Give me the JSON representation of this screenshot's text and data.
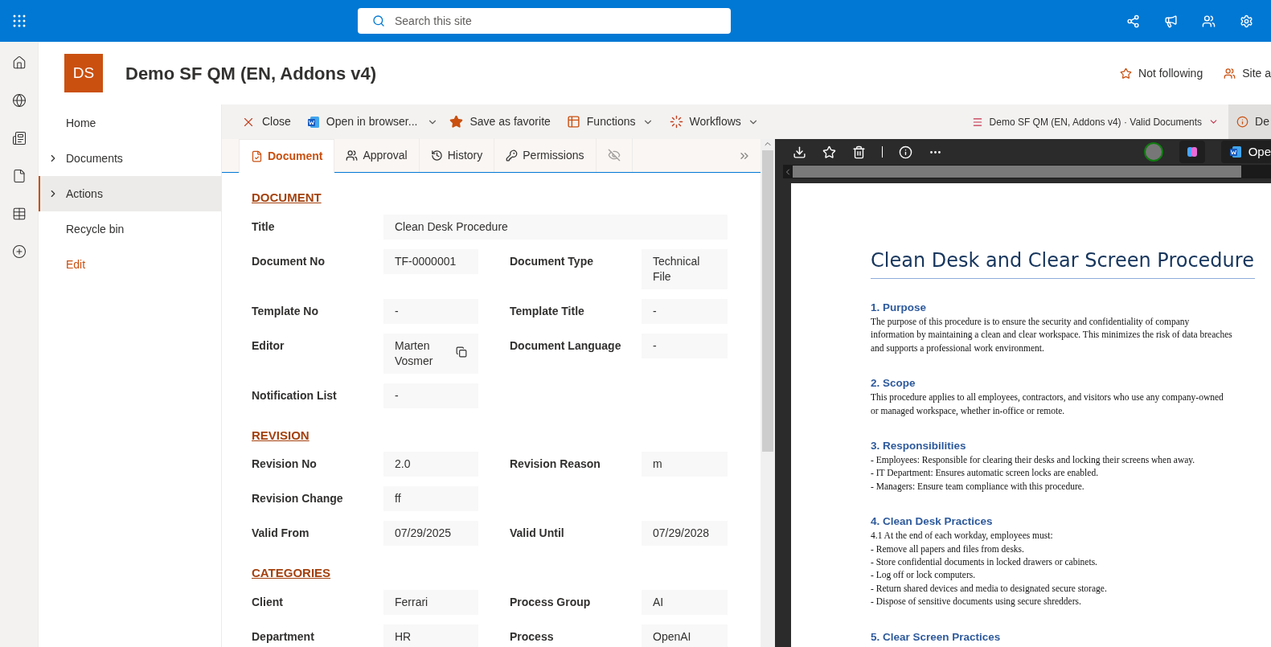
{
  "top_bar": {
    "search": {
      "placeholder": "Search this site"
    }
  },
  "site": {
    "logo": "DS",
    "title": "Demo SF QM (EN, Addons v4)",
    "actions": [
      {
        "kind": "follow",
        "label": "Not following"
      },
      {
        "kind": "members",
        "label": "Site a"
      }
    ]
  },
  "nav": [
    {
      "label": "Home",
      "expandable": false,
      "selected": false,
      "kind": "item"
    },
    {
      "label": "Documents",
      "expandable": true,
      "selected": false,
      "kind": "item"
    },
    {
      "label": "Actions",
      "expandable": true,
      "selected": true,
      "kind": "item"
    },
    {
      "label": "Recycle bin",
      "expandable": false,
      "selected": false,
      "kind": "item"
    },
    {
      "label": "Edit",
      "expandable": false,
      "selected": false,
      "kind": "link"
    }
  ],
  "command_bar": {
    "commands": [
      {
        "kind": "close",
        "label": "Close",
        "dropdown": false
      },
      {
        "kind": "word",
        "label": "Open in browser...",
        "dropdown": true
      },
      {
        "kind": "favorite",
        "label": "Save as favorite",
        "dropdown": false
      },
      {
        "kind": "functions",
        "label": "Functions",
        "dropdown": true
      },
      {
        "kind": "workflows",
        "label": "Workflows",
        "dropdown": true
      }
    ],
    "breadcrumb": "Demo SF QM (EN, Addons v4) · Valid Documents",
    "info_button": "De"
  },
  "tabs": [
    {
      "kind": "document",
      "label": "Document",
      "selected": true
    },
    {
      "kind": "approval",
      "label": "Approval",
      "selected": false
    },
    {
      "kind": "history",
      "label": "History",
      "selected": false
    },
    {
      "kind": "permissions",
      "label": "Permissions",
      "selected": false
    },
    {
      "kind": "hidden",
      "selected": false
    }
  ],
  "sections": [
    {
      "title": "DOCUMENT",
      "rows": [
        [
          {
            "label": "Title",
            "value": "Clean Desk Procedure"
          }
        ],
        [
          {
            "label": "Document No",
            "value": "TF-0000001"
          },
          {
            "label": "Document Type",
            "value": "Technical File"
          }
        ],
        [
          {
            "label": "Template No",
            "value": "-"
          },
          {
            "label": "Template Title",
            "value": "-"
          }
        ],
        [
          {
            "label": "Editor",
            "value": "Marten Vosmer",
            "copyable": true
          },
          {
            "label": "Document Language",
            "value": "-"
          }
        ],
        [
          {
            "label": "Notification List",
            "value": "-"
          }
        ]
      ]
    },
    {
      "title": "REVISION",
      "rows": [
        [
          {
            "label": "Revision No",
            "value": "2.0"
          },
          {
            "label": "Revision Reason",
            "value": "m"
          }
        ],
        [
          {
            "label": "Revision Change",
            "value": "ff"
          }
        ],
        [
          {
            "label": "Valid From",
            "value": "07/29/2025"
          },
          {
            "label": "Valid Until",
            "value": "07/29/2028"
          }
        ]
      ]
    },
    {
      "title": "CATEGORIES",
      "rows": [
        [
          {
            "label": "Client",
            "value": "Ferrari"
          },
          {
            "label": "Process Group",
            "value": "AI"
          }
        ],
        [
          {
            "label": "Department",
            "value": "HR"
          },
          {
            "label": "Process",
            "value": "OpenAI"
          }
        ]
      ]
    }
  ],
  "viewer": {
    "open_button": "Ope",
    "document": {
      "title": "Clean Desk and Clear Screen Procedure",
      "sections": [
        {
          "heading": "1. Purpose",
          "lines": [
            "The purpose of this procedure is to ensure the security and confidentiality of company information by maintaining a clean and clear workspace. This minimizes the risk of data breaches and supports a professional work environment."
          ]
        },
        {
          "heading": "2. Scope",
          "lines": [
            "This procedure applies to all employees, contractors, and visitors who use any company-owned or managed workspace, whether in-office or remote."
          ]
        },
        {
          "heading": "3. Responsibilities",
          "lines": [
            "- Employees: Responsible for clearing their desks and locking their screens when away.",
            "- IT Department: Ensures automatic screen locks are enabled.",
            "- Managers: Ensure team compliance with this procedure."
          ]
        },
        {
          "heading": "4. Clean Desk Practices",
          "lines": [
            "4.1 At the end of each workday, employees must:",
            "- Remove all papers and files from desks.",
            "- Store confidential documents in locked drawers or cabinets.",
            "- Log off or lock computers.",
            "- Return shared devices and media to designated secure storage.",
            "- Dispose of sensitive documents using secure shredders."
          ]
        },
        {
          "heading": "5. Clear Screen Practices"
        }
      ]
    }
  }
}
